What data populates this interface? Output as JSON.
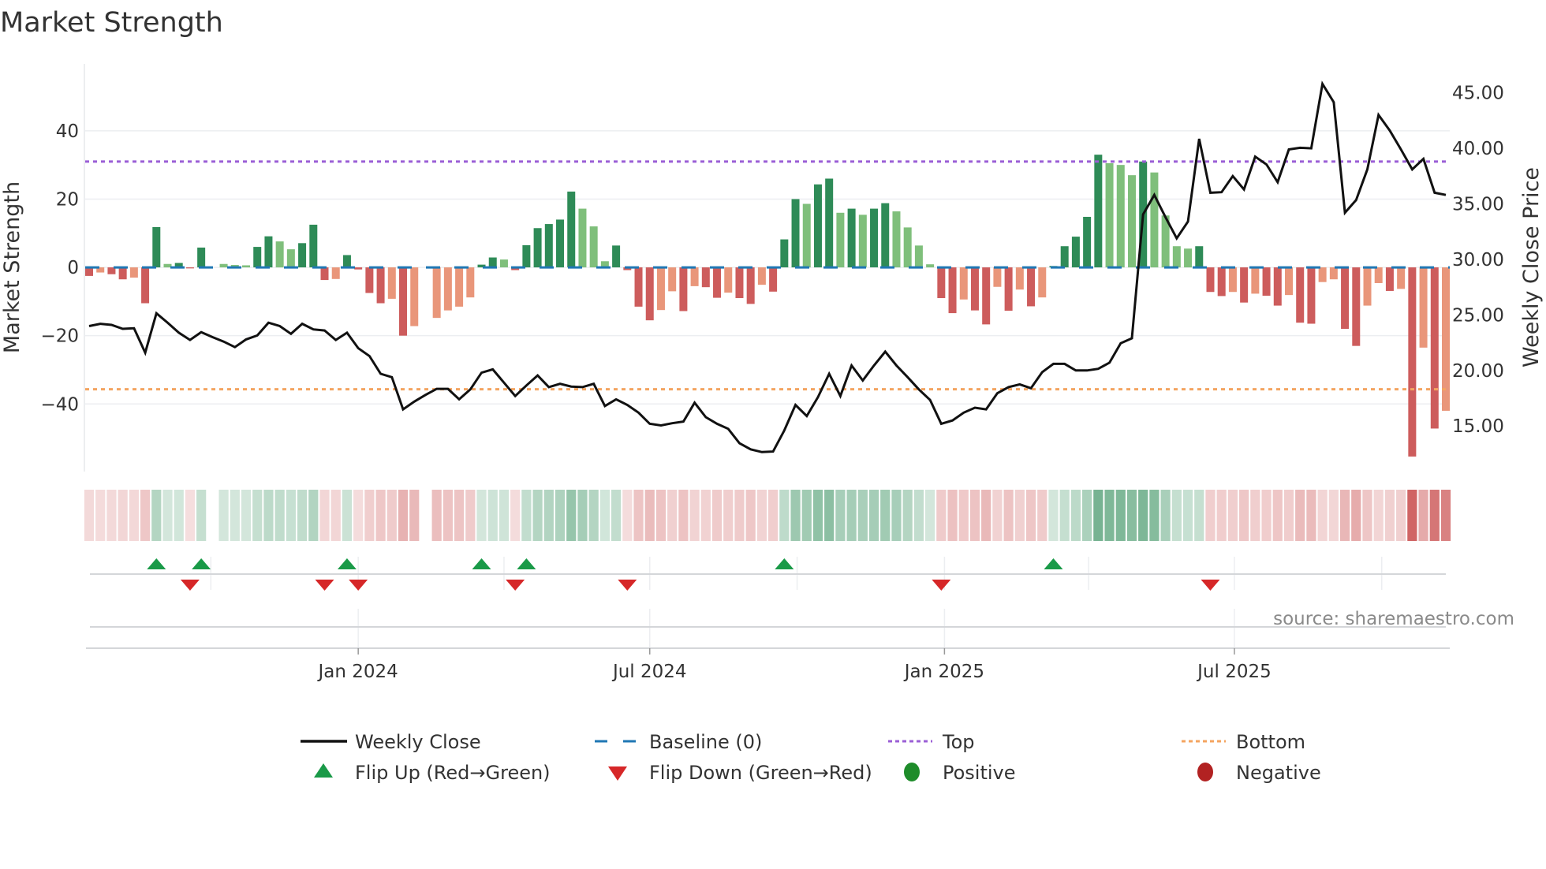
{
  "chart_data": {
    "type": "bar",
    "title": "Market Strength",
    "ylabel": "Market Strength",
    "ylabel_right": "Weekly Close Price",
    "source": "source: sharemaestro.com",
    "start_week": "2023-07-17",
    "frequency": "weekly",
    "ylim": [
      -59.8,
      59.6
    ],
    "ylim_right": [
      10.9,
      47.6
    ],
    "y_ticks": [
      40,
      20,
      0,
      -20,
      -40
    ],
    "y_tick_labels": [
      "40",
      "20",
      "0",
      "−20",
      "−40"
    ],
    "y_right_ticks": [
      45,
      40,
      35,
      30,
      25,
      20,
      15
    ],
    "y_right_tick_labels": [
      "45.00",
      "40.00",
      "35.00",
      "30.00",
      "25.00",
      "20.00",
      "15.00"
    ],
    "x_ticks": [
      {
        "date": "2024-01-01",
        "label": "Jan 2024"
      },
      {
        "date": "2024-07-01",
        "label": "Jul 2024"
      },
      {
        "date": "2025-01-01",
        "label": "Jan 2025"
      },
      {
        "date": "2025-07-01",
        "label": "Jul 2025"
      }
    ],
    "top_level": 31,
    "bottom_level": -35.7,
    "baseline": 0,
    "strength": [
      -2.5,
      -1.5,
      -2,
      -3.5,
      -3,
      -10.5,
      11.8,
      1,
      1.3,
      -0.3,
      5.8,
      null,
      1,
      0.7,
      0.6,
      6,
      9.1,
      7.6,
      5.3,
      7.1,
      12.5,
      -3.7,
      -3.4,
      3.6,
      -0.6,
      -7.5,
      -10.5,
      -9.2,
      -20,
      -17.2,
      null,
      -14.8,
      -12.6,
      -11.5,
      -8.8,
      0.8,
      2.9,
      2.3,
      -0.8,
      6.5,
      11.5,
      12.7,
      14,
      22.2,
      17.2,
      12,
      1.8,
      6.4,
      -0.8,
      -11.5,
      -15.5,
      -12.5,
      -7,
      -12.8,
      -5.5,
      -5.8,
      -8.9,
      -7.4,
      -9,
      -10.7,
      -5.1,
      -7.1,
      8.2,
      20,
      18.6,
      24.3,
      26,
      16,
      17.2,
      15.4,
      17.2,
      18.8,
      16.4,
      11.7,
      6.4,
      0.9,
      -9,
      -13.4,
      -9.4,
      -12.6,
      -16.7,
      -5.7,
      -12.7,
      -6.5,
      -11.4,
      -8.8,
      0.4,
      6.2,
      9,
      14.8,
      33,
      30.5,
      30,
      27,
      31,
      27.8,
      15.2,
      6.2,
      5.5,
      6.2,
      -7.2,
      -8.4,
      -7.2,
      -10.3,
      -7.7,
      -8.3,
      -11.2,
      -8.1,
      -16.2,
      -16.5,
      -4.3,
      -3.5,
      -18,
      -23,
      -11.2,
      -4.6,
      -6.9,
      -6.3,
      -55.4,
      -23.5,
      -47.2,
      -42
    ],
    "weekly_close": [
      24.0,
      24.2,
      24.1,
      23.75,
      23.8,
      21.6,
      25.15,
      24.3,
      23.4,
      22.75,
      23.45,
      23.0,
      22.6,
      22.1,
      22.8,
      23.15,
      24.3,
      24.0,
      23.3,
      24.2,
      23.7,
      23.6,
      22.75,
      23.4,
      22.0,
      21.3,
      19.7,
      19.4,
      16.5,
      17.2,
      17.8,
      18.35,
      18.35,
      17.4,
      18.3,
      19.8,
      20.1,
      18.9,
      17.7,
      18.65,
      19.55,
      18.5,
      18.8,
      18.55,
      18.5,
      18.8,
      16.8,
      17.4,
      16.9,
      16.2,
      15.2,
      15.05,
      15.25,
      15.4,
      17.1,
      15.8,
      15.2,
      14.75,
      13.45,
      12.9,
      12.65,
      12.7,
      14.6,
      16.9,
      15.9,
      17.6,
      19.7,
      17.7,
      20.45,
      19.1,
      20.45,
      21.7,
      20.45,
      19.4,
      18.3,
      17.35,
      15.2,
      15.5,
      16.2,
      16.65,
      16.5,
      17.95,
      18.5,
      18.75,
      18.4,
      19.85,
      20.6,
      20.6,
      20.0,
      20.0,
      20.15,
      20.7,
      22.45,
      22.9,
      34.05,
      35.8,
      33.8,
      31.9,
      33.4,
      40.85,
      36.0,
      36.05,
      37.5,
      36.3,
      39.25,
      38.55,
      36.95,
      39.9,
      40.05,
      40.0,
      45.8,
      44.15,
      34.2,
      35.35,
      38.1,
      43.0,
      41.6,
      39.9,
      38.1,
      39.05,
      36.0,
      35.8
    ],
    "flip_up_weeks": [
      6,
      10,
      23,
      35,
      39,
      62,
      86
    ],
    "flip_down_weeks": [
      9,
      21,
      24,
      38,
      48,
      76,
      100
    ],
    "legend": [
      {
        "label": "Weekly Close",
        "kind": "line"
      },
      {
        "label": "Baseline (0)",
        "kind": "dashed"
      },
      {
        "label": "Top",
        "kind": "dotted-top"
      },
      {
        "label": "Bottom",
        "kind": "dotted-bottom"
      },
      {
        "label": "Flip Up (Red→Green)",
        "kind": "tri-up"
      },
      {
        "label": "Flip Down (Green→Red)",
        "kind": "tri-down"
      },
      {
        "label": "Positive",
        "kind": "dot-pos"
      },
      {
        "label": "Negative",
        "kind": "dot-neg"
      }
    ],
    "legend_placement": "bottom",
    "colors": {
      "pos_strong": "#2e8b57",
      "pos_weak": "#7fbf7b",
      "neg_strong": "#cd5c5c",
      "neg_weak": "#e9967a",
      "close": "#111111",
      "baseline": "#1f77b4",
      "top": "#9b5fd6",
      "bottom": "#f4a460",
      "flip_up": "#1a9a48",
      "flip_down": "#d62728",
      "legend_pos": "#1e8c2a",
      "legend_neg": "#b22222"
    }
  }
}
